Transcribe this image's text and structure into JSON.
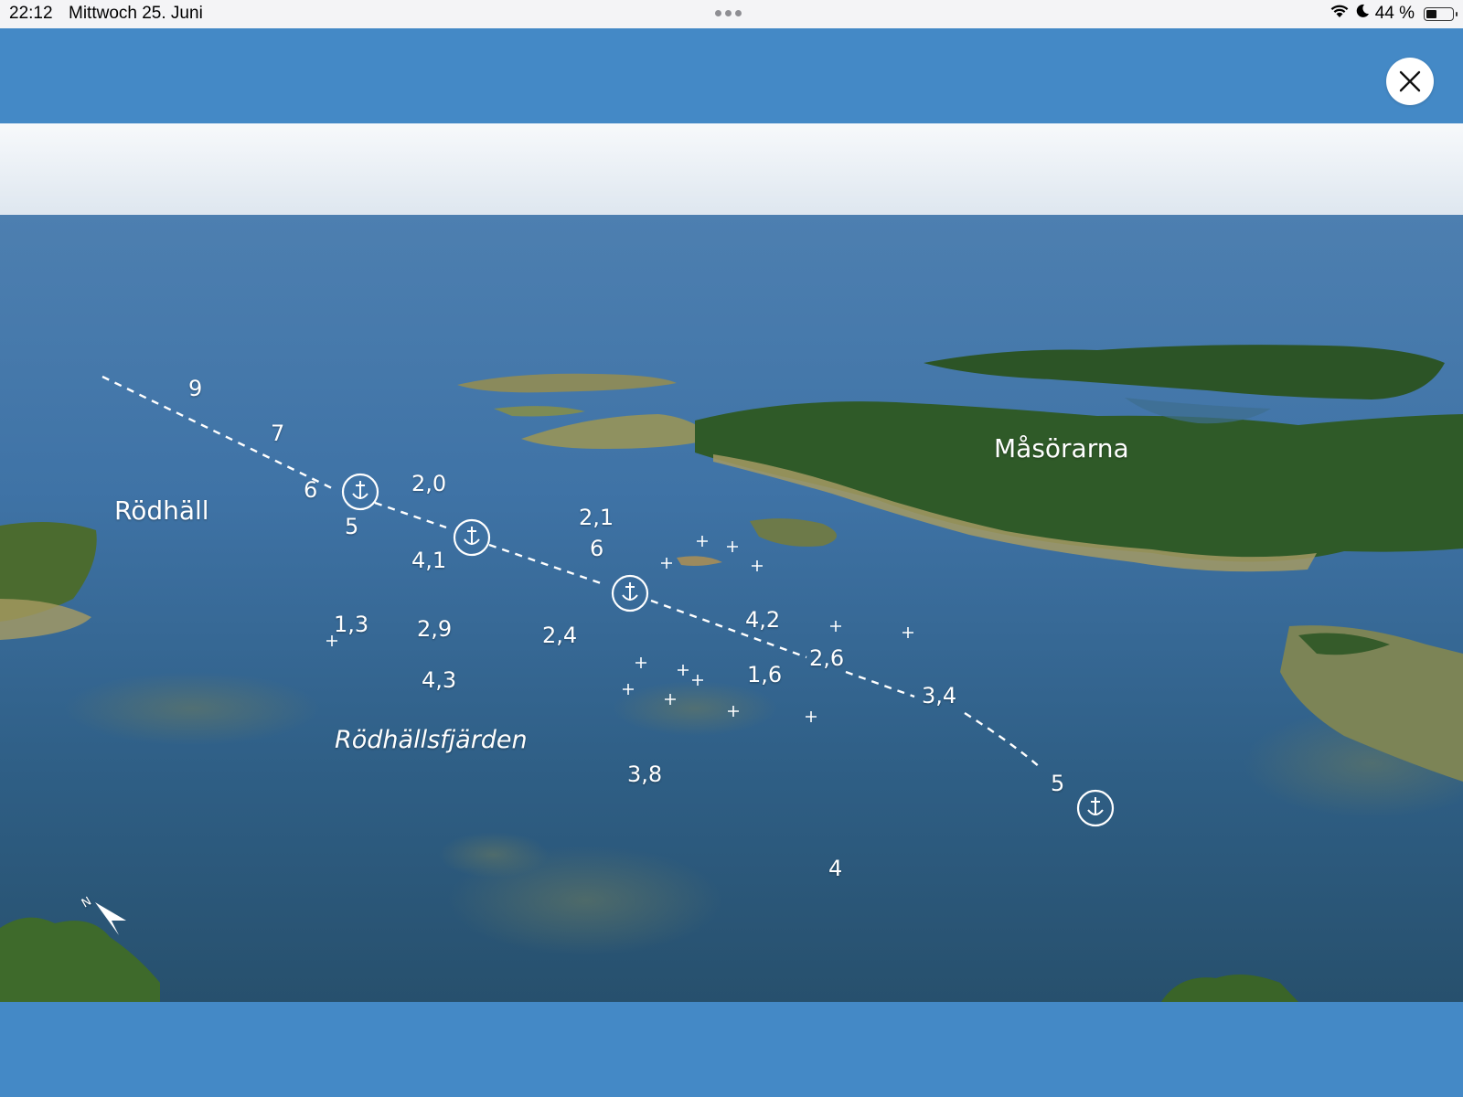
{
  "status_bar": {
    "time": "22:12",
    "date": "Mittwoch 25. Juni",
    "battery_percent": "44 %",
    "battery_level": 0.44
  },
  "header": {
    "close_icon": "close-icon",
    "band_color": "#4489c6"
  },
  "chart": {
    "place_names": {
      "rodhall": "Rödhäll",
      "masorarna": "Måsörarna",
      "fjarden": "Rödhällsfjärden"
    },
    "depths": [
      "9",
      "7",
      "6",
      "5",
      "2,0",
      "2,1",
      "6",
      "4,1",
      "1,3",
      "2,9",
      "2,4",
      "4,2",
      "2,6",
      "3,4",
      "1,6",
      "4,3",
      "3,8",
      "5",
      "4"
    ],
    "anchor_icon": "anchor-icon",
    "rock_icon": "rock-cross-icon",
    "north_arrow_label": "N",
    "north_arrow_icon": "north-arrow-icon",
    "route_icon": "dashed-route-line"
  }
}
